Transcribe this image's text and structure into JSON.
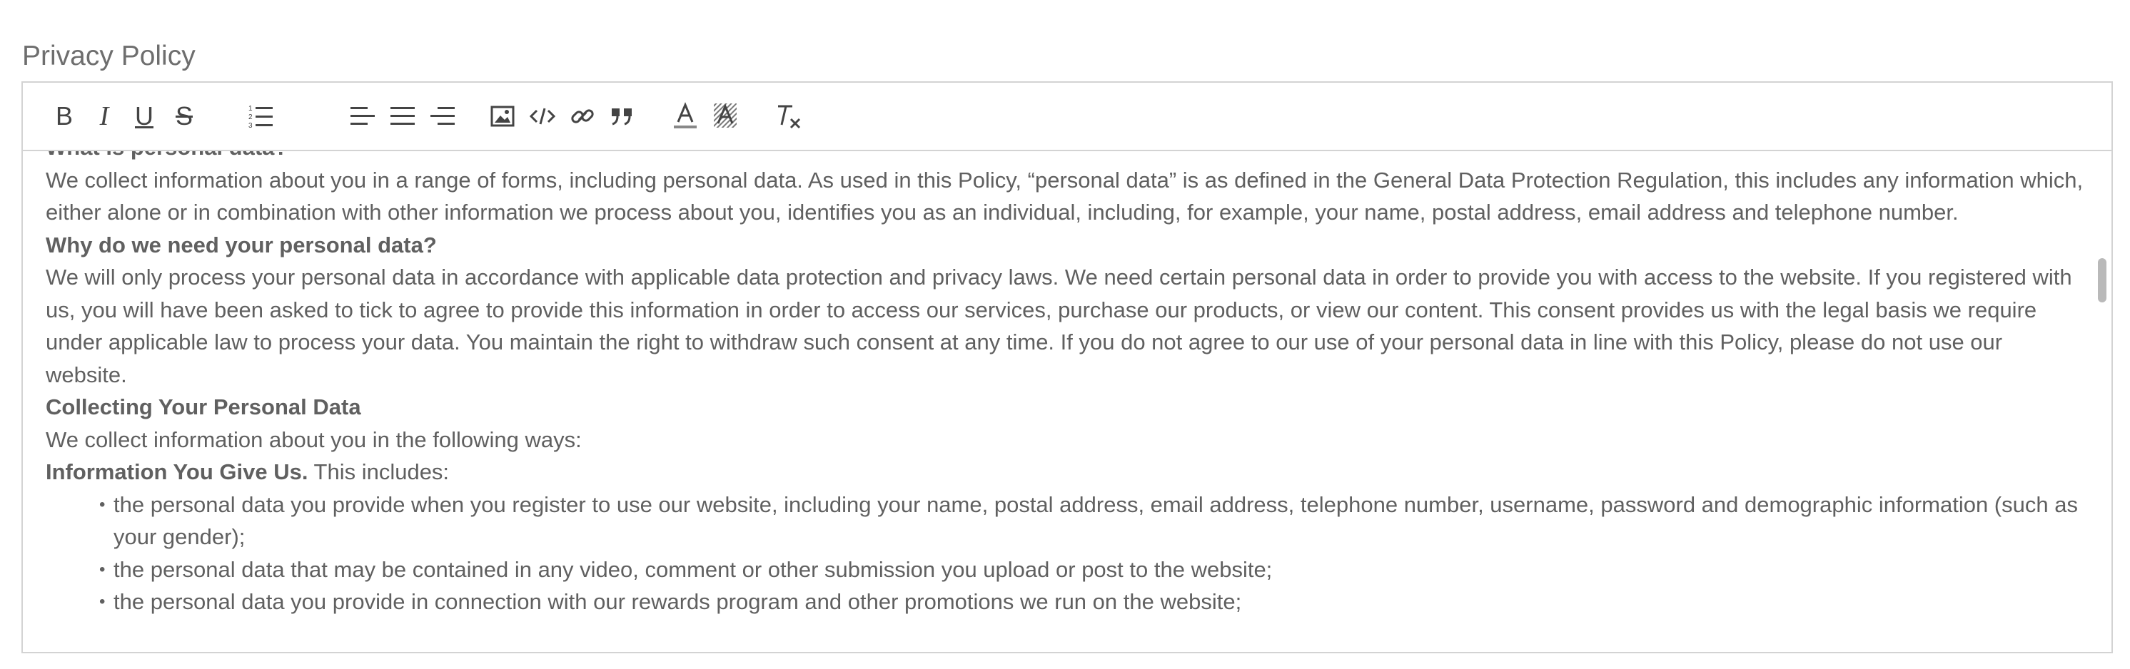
{
  "field_label": "Privacy Policy",
  "toolbar": {
    "buttons": [
      {
        "name": "bold",
        "glyph": "B"
      },
      {
        "name": "italic",
        "glyph": "I"
      },
      {
        "name": "underline",
        "glyph": "U"
      },
      {
        "name": "strikethrough",
        "glyph": "S"
      }
    ]
  },
  "content": {
    "heading_1": "What is personal data?",
    "para_1": "We collect information about you in a range of forms, including personal data. As used in this Policy, “personal data” is as defined in the General Data Protection Regulation, this includes any information which, either alone or in combination with other information we process about you, identifies you as an individual, including, for example, your name, postal address, email address and telephone number.",
    "heading_2": "Why do we need your personal data?",
    "para_2": "We will only process your personal data in accordance with applicable data protection and privacy laws. We need certain personal data in order to provide you with access to the website. If you registered with us, you will have been asked to tick to agree to provide this information in order to access our services, purchase our products, or view our content. This consent provides us with the legal basis we require under applicable law to process your data. You maintain the right to withdraw such consent at any time. If you do not agree to our use of your personal data in line with this Policy, please do not use our website.",
    "heading_3": "Collecting Your Personal Data",
    "para_3": "We collect information about you in the following ways:",
    "info_bold": "Information You Give Us.",
    "info_rest": " This includes:",
    "bullets": [
      "the personal data you provide when you register to use our website, including your name, postal address, email address, telephone number, username, password and demographic information (such as your gender);",
      "the personal data that may be contained in any video, comment or other submission you upload or post to the website;",
      "the personal data you provide in connection with our rewards program and other promotions we run on the website;"
    ]
  },
  "scroll": {
    "position_fraction": 0.05
  }
}
